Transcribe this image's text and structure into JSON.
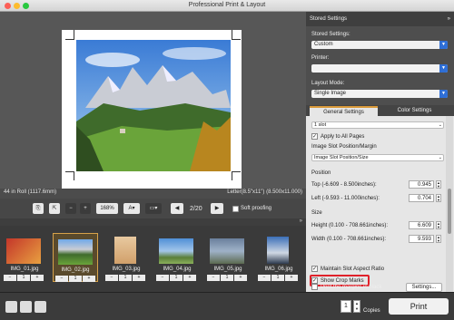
{
  "window": {
    "title": "Professional Print & Layout"
  },
  "preview": {
    "roll_info": "44 in Roll (1117.6mm)",
    "paper_size": "Letter(8.5\"x11\") (8.500x11.000)"
  },
  "toolbar": {
    "zoom": "168%",
    "page": "2/20",
    "soft_proofing_label": "Soft proofing"
  },
  "thumbnails": [
    {
      "name": "IMG_01.jpg",
      "count": "1"
    },
    {
      "name": "IMG_02.jpg",
      "count": "1",
      "selected": true
    },
    {
      "name": "IMG_03.jpg",
      "count": "1"
    },
    {
      "name": "IMG_04.jpg",
      "count": "1"
    },
    {
      "name": "IMG_05.jpg",
      "count": "1"
    },
    {
      "name": "IMG_06.jpg",
      "count": "1"
    }
  ],
  "stepper": {
    "minus": "−",
    "plus": "+"
  },
  "stored_settings": {
    "header": "Stored Settings",
    "label": "Stored Settings:",
    "value": "Custom",
    "printer_label": "Printer:",
    "printer_value": "",
    "layout_mode_label": "Layout Mode:",
    "layout_mode_value": "Single Image"
  },
  "tabs": {
    "general": "General Settings",
    "color": "Color Settings"
  },
  "general": {
    "slot_value": "1 slot",
    "apply_all_label": "Apply to All Pages",
    "position_margin_label": "Image Slot Position/Margin",
    "position_margin_value": "Image Slot Position/Size",
    "position_label": "Position",
    "top_label": "Top (-6.609 - 8.500inches):",
    "top_value": "0.945",
    "left_label": "Left (-9.593 - 11.000inches):",
    "left_value": "0.704",
    "size_label": "Size",
    "height_label": "Height (0.100 - 708.661inches):",
    "height_value": "6.609",
    "width_label": "Width (0.100 - 708.661inches):",
    "width_value": "9.593",
    "maintain_ratio_label": "Maintain Slot Aspect Ratio",
    "show_crop_marks_label": "Show Crop Marks",
    "settings_button": "Settings...",
    "print_margins_label": "Print the margins in black"
  },
  "footer": {
    "copies_value": "1",
    "copies_label": "Copies",
    "print_button": "Print"
  },
  "colors": {
    "accent": "#d99a3a",
    "highlight": "#e0212a",
    "select_blue": "#2f6fd6"
  }
}
